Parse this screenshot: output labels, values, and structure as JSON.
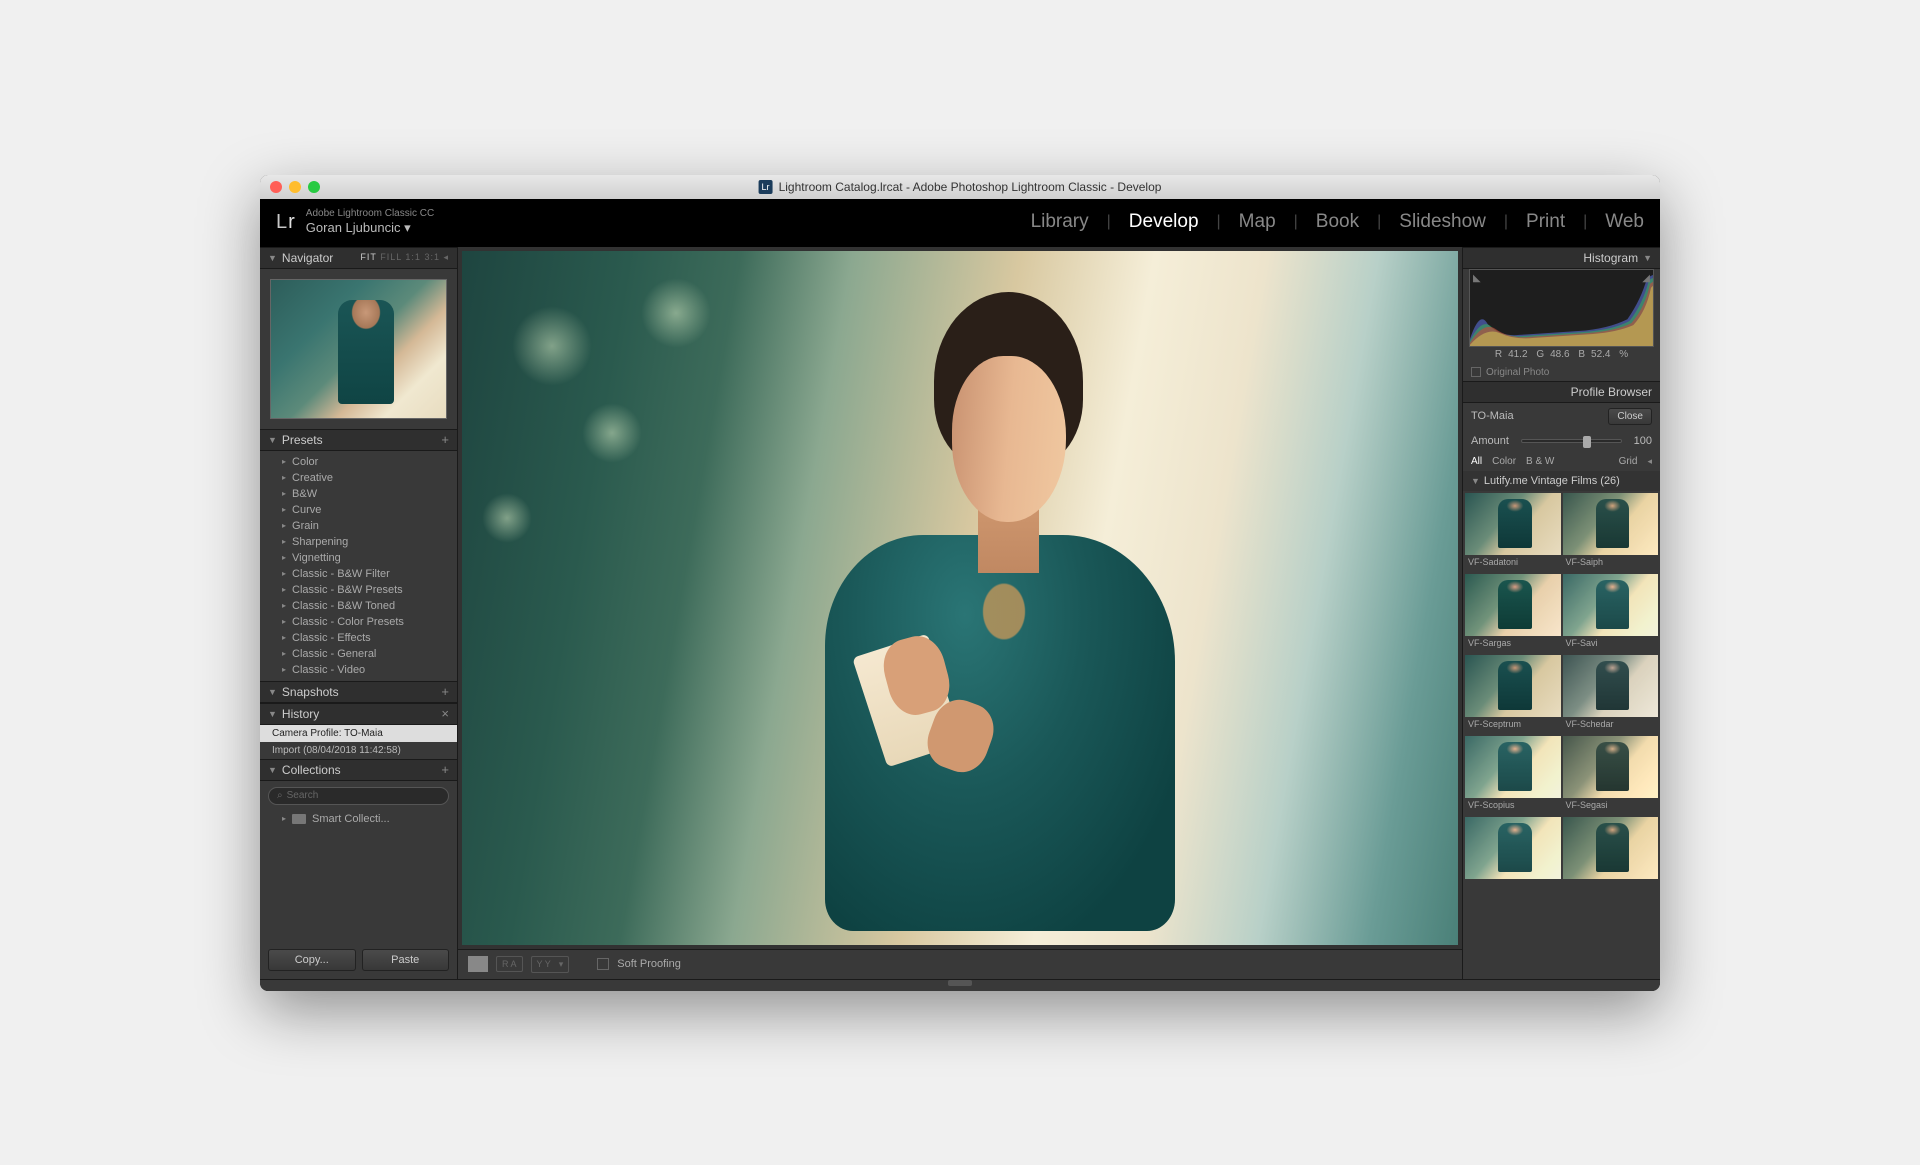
{
  "window": {
    "title": "Lightroom Catalog.lrcat - Adobe Photoshop Lightroom Classic - Develop"
  },
  "brand": {
    "app_line": "Adobe Lightroom Classic CC",
    "user_name": "Goran Ljubuncic"
  },
  "modules": [
    "Library",
    "Develop",
    "Map",
    "Book",
    "Slideshow",
    "Print",
    "Web"
  ],
  "active_module": "Develop",
  "navigator": {
    "title": "Navigator",
    "zoom": {
      "fit": "FIT",
      "fill": "FILL",
      "one": "1:1",
      "three": "3:1"
    }
  },
  "presets": {
    "title": "Presets",
    "items": [
      "Color",
      "Creative",
      "B&W",
      "Curve",
      "Grain",
      "Sharpening",
      "Vignetting",
      "Classic - B&W Filter",
      "Classic - B&W Presets",
      "Classic - B&W Toned",
      "Classic - Color Presets",
      "Classic - Effects",
      "Classic - General",
      "Classic - Video"
    ]
  },
  "snapshots": {
    "title": "Snapshots"
  },
  "history": {
    "title": "History",
    "items": [
      "Camera Profile: TO-Maia",
      "Import (08/04/2018 11:42:58)"
    ]
  },
  "collections": {
    "title": "Collections",
    "search_placeholder": "Search",
    "items": [
      "Smart Collecti..."
    ]
  },
  "buttons": {
    "copy": "Copy...",
    "paste": "Paste"
  },
  "toolbar": {
    "soft_proofing": "Soft Proofing",
    "ra": "R A",
    "yy": "Y Y"
  },
  "histogram": {
    "title": "Histogram",
    "r_label": "R",
    "r_val": "41.2",
    "g_label": "G",
    "g_val": "48.6",
    "b_label": "B",
    "b_val": "52.4",
    "pct": "%",
    "original_photo": "Original Photo"
  },
  "profile_browser": {
    "title": "Profile Browser",
    "name": "TO-Maia",
    "close": "Close",
    "amount_label": "Amount",
    "amount_value": "100",
    "filters": {
      "all": "All",
      "color": "Color",
      "bw": "B & W",
      "grid": "Grid"
    },
    "group": "Lutify.me Vintage Films (26)",
    "profiles": [
      "VF-Sadatoni",
      "VF-Saiph",
      "VF-Sargas",
      "VF-Savi",
      "VF-Sceptrum",
      "VF-Schedar",
      "VF-Scopius",
      "VF-Segasi"
    ]
  }
}
